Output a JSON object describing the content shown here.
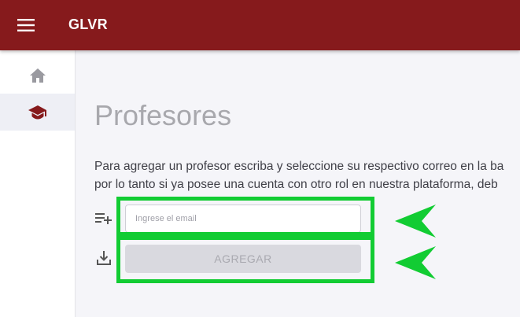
{
  "app": {
    "title": "GLVR"
  },
  "colors": {
    "appbar": "#861a1c",
    "accent_icon": "#861a1c",
    "highlight": "#12cc33"
  },
  "sidebar": {
    "items": [
      {
        "name": "home",
        "icon": "home-icon"
      },
      {
        "name": "teachers",
        "icon": "graduation-cap-icon",
        "active": true
      }
    ]
  },
  "main": {
    "title": "Profesores",
    "description_line1": "Para agregar un profesor escriba y seleccione su respectivo correo en la ba",
    "description_line2": "por lo tanto si ya posee una cuenta con otro rol en nuestra plataforma, deb",
    "email_placeholder": "Ingrese el email",
    "add_button_label": "AGREGAR"
  }
}
